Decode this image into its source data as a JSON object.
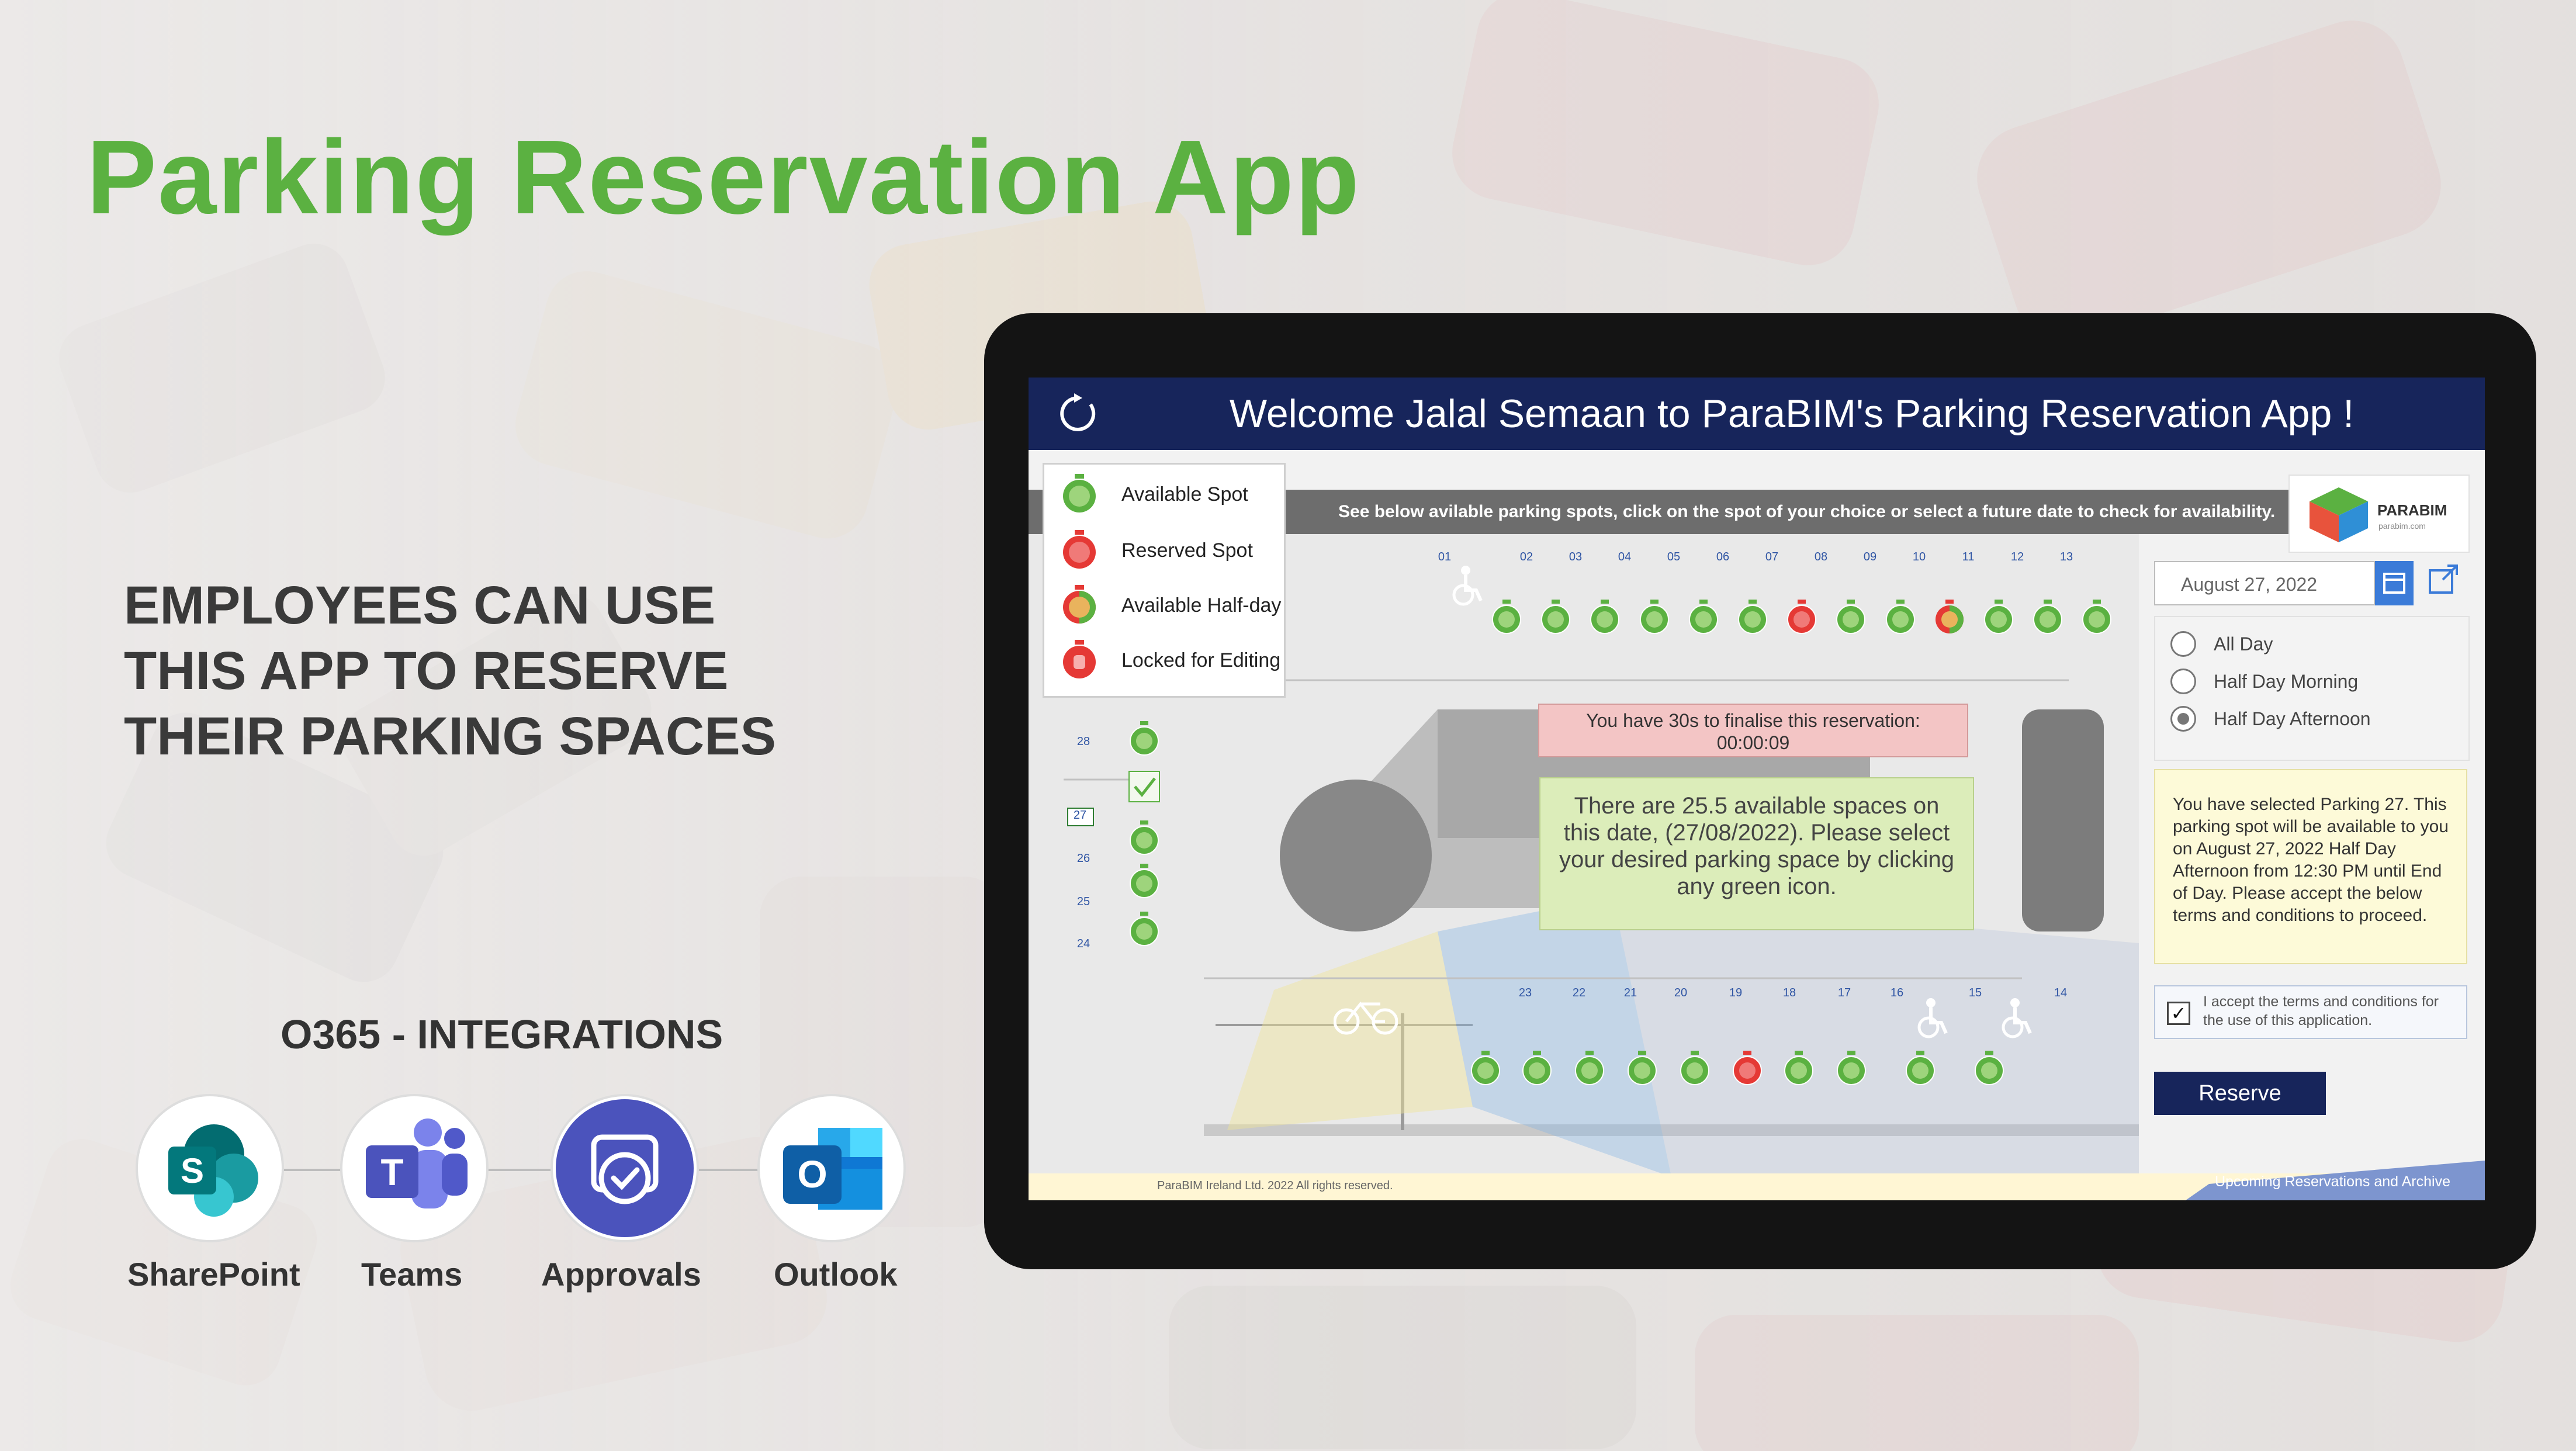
{
  "heading": "Parking Reservation App",
  "pitch": "EMPLOYEES CAN USE\nTHIS APP TO RESERVE\nTHEIR PARKING SPACES",
  "integrations": {
    "title": "O365 - INTEGRATIONS",
    "apps": [
      {
        "name": "SharePoint",
        "icon": "sharepoint-icon",
        "color": "#038387"
      },
      {
        "name": "Teams",
        "icon": "teams-icon",
        "color": "#5059c9"
      },
      {
        "name": "Approvals",
        "icon": "approvals-icon",
        "color": "#4b53bc"
      },
      {
        "name": "Outlook",
        "icon": "outlook-icon",
        "color": "#0f6cbd"
      }
    ]
  },
  "app": {
    "welcome": "Welcome Jalal Semaan to ParaBIM's Parking Reservation App !",
    "instruction": "See below avilable parking spots, click on the spot of your choice or select a future date to check for availability.",
    "legend": [
      {
        "label": "Available Spot",
        "status": "available"
      },
      {
        "label": "Reserved Spot",
        "status": "reserved"
      },
      {
        "label": "Available Half-day",
        "status": "half"
      },
      {
        "label": "Locked for Editing",
        "status": "locked"
      }
    ],
    "colors": {
      "available": "#5bb141",
      "reserved": "#e53935",
      "bar": "#17255b",
      "button": "#17255b"
    },
    "top_row": [
      {
        "num": "01",
        "status": "accessible"
      },
      {
        "num": "02",
        "status": "available"
      },
      {
        "num": "03",
        "status": "available"
      },
      {
        "num": "04",
        "status": "available"
      },
      {
        "num": "05",
        "status": "available"
      },
      {
        "num": "06",
        "status": "available"
      },
      {
        "num": "07",
        "status": "available"
      },
      {
        "num": "08",
        "status": "reserved"
      },
      {
        "num": "09",
        "status": "available"
      },
      {
        "num": "10",
        "status": "available"
      },
      {
        "num": "11",
        "status": "half"
      },
      {
        "num": "12",
        "status": "available"
      },
      {
        "num": "13",
        "status": "available"
      },
      {
        "num": "",
        "status": "available"
      }
    ],
    "left_col": [
      {
        "num": "28",
        "status": "available"
      },
      {
        "num": "27",
        "status": "selected"
      },
      {
        "num": "26",
        "status": "available"
      },
      {
        "num": "25",
        "status": "available"
      },
      {
        "num": "24",
        "status": "available"
      }
    ],
    "bottom_row": [
      {
        "num": "23",
        "status": "available"
      },
      {
        "num": "22",
        "status": "available"
      },
      {
        "num": "21",
        "status": "available"
      },
      {
        "num": "20",
        "status": "available"
      },
      {
        "num": "19",
        "status": "available"
      },
      {
        "num": "18",
        "status": "reserved"
      },
      {
        "num": "17",
        "status": "available"
      },
      {
        "num": "16",
        "status": "available"
      },
      {
        "num": "15",
        "status": "available"
      },
      {
        "num": "14",
        "status": "available"
      }
    ],
    "timer_line1": "You have 30s to finalise this reservation:",
    "timer_line2": "00:00:09",
    "availability_msg": "There are 25.5 available spaces on this date, (27/08/2022). Please select your desired parking space by clicking any green icon.",
    "logo_text": "PARABIM",
    "logo_sub": "parabim.com",
    "date_value": "August 27, 2022",
    "options": [
      {
        "label": "All Day",
        "selected": false
      },
      {
        "label": "Half Day Morning",
        "selected": false
      },
      {
        "label": "Half Day Afternoon",
        "selected": true
      }
    ],
    "selection_info": "You have selected Parking 27. This parking spot will be available to you on August 27, 2022 Half Day Afternoon from 12:30 PM until End of Day. Please accept the below terms and conditions to proceed.",
    "terms_text": "I accept the terms and conditions for the use of this application.",
    "terms_checked": "✓",
    "reserve_label": "Reserve",
    "footer_copy": "ParaBIM Ireland Ltd. 2022 All rights reserved.",
    "upcoming_label": "Upcoming Reservations and Archive"
  }
}
